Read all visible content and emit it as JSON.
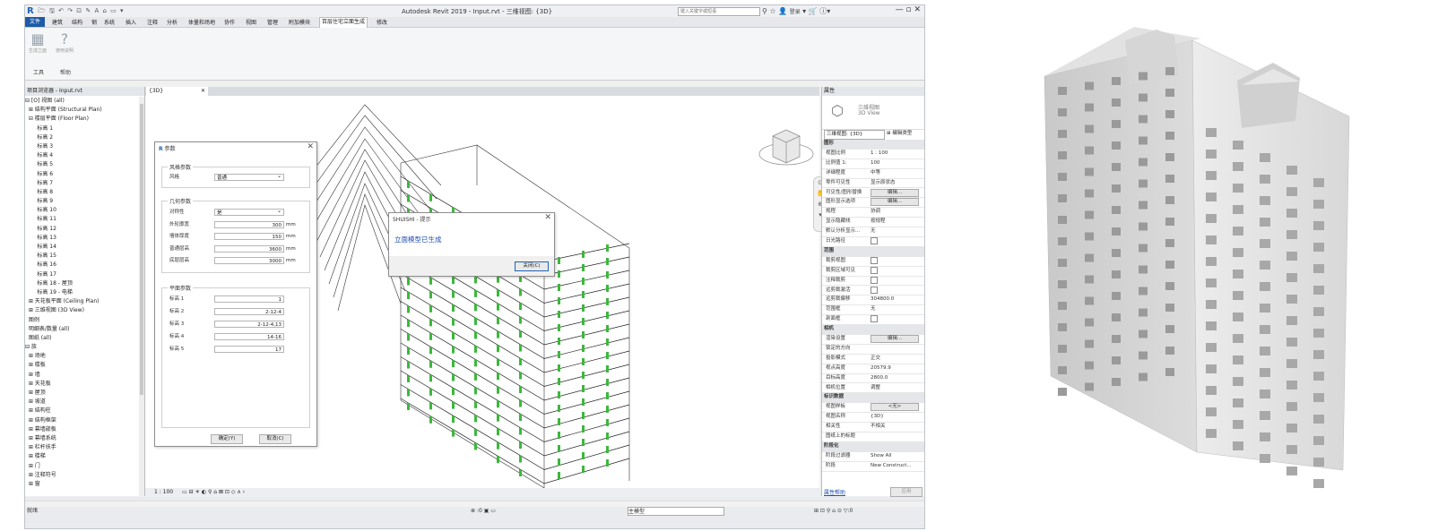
{
  "window": {
    "title": "Autodesk Revit 2019 - Input.rvt - 三维视图: {3D}",
    "search_placeholder": "键入关键字或短语",
    "user": "登录"
  },
  "menu": [
    "建筑",
    "结构",
    "钢",
    "系统",
    "插入",
    "注释",
    "分析",
    "体量和场地",
    "协作",
    "视图",
    "管理",
    "附加模块",
    "百层住宅立面生成",
    "修改"
  ],
  "menu_file": "文件",
  "ribbon": {
    "btn1": "生成立面",
    "btn2": "使用说明",
    "panel1": "工具",
    "panel2": "帮助"
  },
  "browser": {
    "title": "项目浏览器 - Input.rvt",
    "items": [
      "⊟ [O] 视图 (all)",
      "  ⊞ 结构平面 (Structural Plan)",
      "  ⊟ 楼层平面 (Floor Plan)",
      "       标高 1",
      "       标高 2",
      "       标高 3",
      "       标高 4",
      "       标高 5",
      "       标高 6",
      "       标高 7",
      "       标高 8",
      "       标高 9",
      "       标高 10",
      "       标高 11",
      "       标高 12",
      "       标高 13",
      "       标高 14",
      "       标高 15",
      "       标高 16",
      "       标高 17",
      "       标高 18 - 屋顶",
      "       标高 19 - 电梯",
      "  ⊞ 天花板平面 (Ceiling Plan)",
      "  ⊞ 三维视图 (3D View)",
      "  图例",
      "  明细表/数量 (all)",
      "  图纸 (all)",
      "⊟ 族",
      "  ⊞ 场地",
      "  ⊞ 楼板",
      "  ⊞ 墙",
      "  ⊞ 天花板",
      "  ⊞ 屋顶",
      "  ⊞ 坡道",
      "  ⊞ 结构柱",
      "  ⊞ 结构框架",
      "  ⊞ 幕墙嵌板",
      "  ⊞ 幕墙系统",
      "  ⊞ 栏杆扶手",
      "  ⊞ 楼梯",
      "  ⊞ 门",
      "  ⊞ 注释符号",
      "  ⊞ 窗"
    ]
  },
  "view": {
    "tab": "{3D}",
    "scale": "1 : 100"
  },
  "param_dialog": {
    "title": "参数",
    "style_group": "风格参数",
    "style_label": "风格",
    "style_value": "普通",
    "geom_group": "几何参数",
    "geom_rows": [
      {
        "label": "对称性",
        "value": "是",
        "unit": ""
      },
      {
        "label": "外轮廓宽",
        "value": "300",
        "unit": "mm"
      },
      {
        "label": "墙体厚度",
        "value": "150",
        "unit": "mm"
      },
      {
        "label": "普通层高",
        "value": "3600",
        "unit": "mm"
      },
      {
        "label": "底层层高",
        "value": "3000",
        "unit": "mm"
      }
    ],
    "plan_group": "平面参数",
    "plan_rows": [
      {
        "label": "标高 1",
        "value": "1"
      },
      {
        "label": "标高 2",
        "value": "2-12-4"
      },
      {
        "label": "标高 3",
        "value": "2-12-4,13"
      },
      {
        "label": "标高 4",
        "value": "14-16"
      },
      {
        "label": "标高 5",
        "value": "17"
      }
    ],
    "ok": "确定(Y)",
    "cancel": "取消(C)"
  },
  "msg_dialog": {
    "title": "SHUISHI - 提示",
    "message": "立面模型已生成",
    "close": "关闭(C)"
  },
  "properties": {
    "title": "属性",
    "type_name": "三维视图",
    "type_sub": "3D View",
    "selector": "三维视图: {3D}",
    "edit_type": "编辑类型",
    "rows": [
      {
        "k": "图形",
        "v": "",
        "cat": true
      },
      {
        "k": "视图比例",
        "v": "1 : 100"
      },
      {
        "k": "比例值 1:",
        "v": "100"
      },
      {
        "k": "详细程度",
        "v": "中等"
      },
      {
        "k": "零件可见性",
        "v": "显示原状态"
      },
      {
        "k": "可见性/图形替换",
        "v": "编辑...",
        "btn": true
      },
      {
        "k": "图形显示选项",
        "v": "编辑...",
        "btn": true
      },
      {
        "k": "规程",
        "v": "协调"
      },
      {
        "k": "显示隐藏线",
        "v": "按规程"
      },
      {
        "k": "默认分析显示...",
        "v": "无"
      },
      {
        "k": "日光路径",
        "v": "",
        "chk": true
      },
      {
        "k": "范围",
        "v": "",
        "cat": true
      },
      {
        "k": "裁剪视图",
        "v": "",
        "chk": true
      },
      {
        "k": "裁剪区域可见",
        "v": "",
        "chk": true
      },
      {
        "k": "注释裁剪",
        "v": "",
        "chk": true
      },
      {
        "k": "远剪裁激活",
        "v": "",
        "chk": true
      },
      {
        "k": "远剪裁偏移",
        "v": "304800.0"
      },
      {
        "k": "范围框",
        "v": "无"
      },
      {
        "k": "剖面框",
        "v": "",
        "chk": true
      },
      {
        "k": "相机",
        "v": "",
        "cat": true
      },
      {
        "k": "渲染设置",
        "v": "编辑...",
        "btn": true
      },
      {
        "k": "锁定的方向",
        "v": ""
      },
      {
        "k": "投影模式",
        "v": "正交"
      },
      {
        "k": "视点高度",
        "v": "20579.9"
      },
      {
        "k": "目标高度",
        "v": "2800.0"
      },
      {
        "k": "相机位置",
        "v": "调整"
      },
      {
        "k": "标识数据",
        "v": "",
        "cat": true
      },
      {
        "k": "视图样板",
        "v": "<无>",
        "btn": true
      },
      {
        "k": "视图名称",
        "v": "{3D}"
      },
      {
        "k": "相关性",
        "v": "不相关"
      },
      {
        "k": "图纸上的标题",
        "v": ""
      },
      {
        "k": "阶段化",
        "v": "",
        "cat": true
      },
      {
        "k": "阶段过滤器",
        "v": "Show All"
      },
      {
        "k": "阶段",
        "v": "New Construct..."
      }
    ],
    "help": "属性帮助",
    "apply": "应用"
  },
  "statusbar": {
    "left": "就绪",
    "zero": ":0",
    "model": "主模型"
  }
}
